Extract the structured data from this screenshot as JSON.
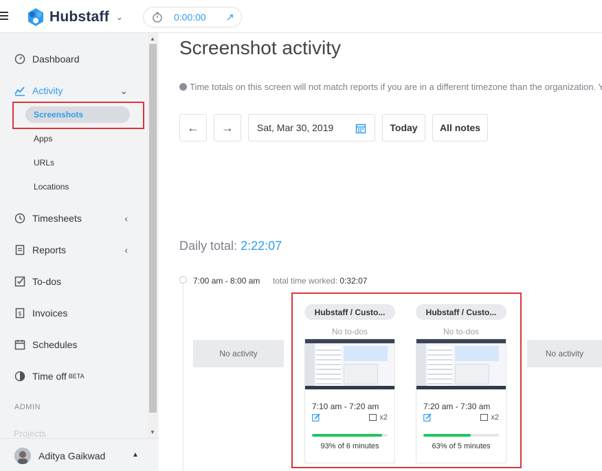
{
  "app": {
    "brand": "Hubstaff",
    "timer": "0:00:00"
  },
  "sidebar": {
    "items": [
      {
        "label": "Dashboard"
      },
      {
        "label": "Activity"
      },
      {
        "label": "Timesheets"
      },
      {
        "label": "Reports"
      },
      {
        "label": "To-dos"
      },
      {
        "label": "Invoices"
      },
      {
        "label": "Schedules"
      },
      {
        "label": "Time off",
        "badge": "BETA"
      }
    ],
    "activity_sub": [
      "Screenshots",
      "Apps",
      "URLs",
      "Locations"
    ],
    "admin_label": "ADMIN",
    "faded_item": "Projects",
    "user": {
      "name": "Aditya Gaikwad"
    }
  },
  "main": {
    "title": "Screenshot activity",
    "tz_note": "Time totals on this screen will not match reports if you are in a different timezone than the organization. Y",
    "date": "Sat, Mar 30, 2019",
    "today_label": "Today",
    "notes_label": "All notes",
    "daily_total_label": "Daily total:",
    "daily_total_value": "2:22:07",
    "slot": {
      "range": "7:00 am - 8:00 am",
      "worked_label": "total time worked:",
      "worked_value": "0:32:07"
    },
    "no_activity": "No activity",
    "cards": [
      {
        "project": "Hubstaff / Custo...",
        "todo": "No to-dos",
        "time": "7:10 am - 7:20 am",
        "count": "x2",
        "activity_pct": 93,
        "pct_text": "93% of 6 minutes"
      },
      {
        "project": "Hubstaff / Custo...",
        "todo": "No to-dos",
        "time": "7:20 am - 7:30 am",
        "count": "x2",
        "activity_pct": 63,
        "pct_text": "63% of 5 minutes"
      }
    ]
  },
  "colors": {
    "accent": "#2f9cf0",
    "highlight": "#d9343a",
    "progress": "#22c55e"
  }
}
